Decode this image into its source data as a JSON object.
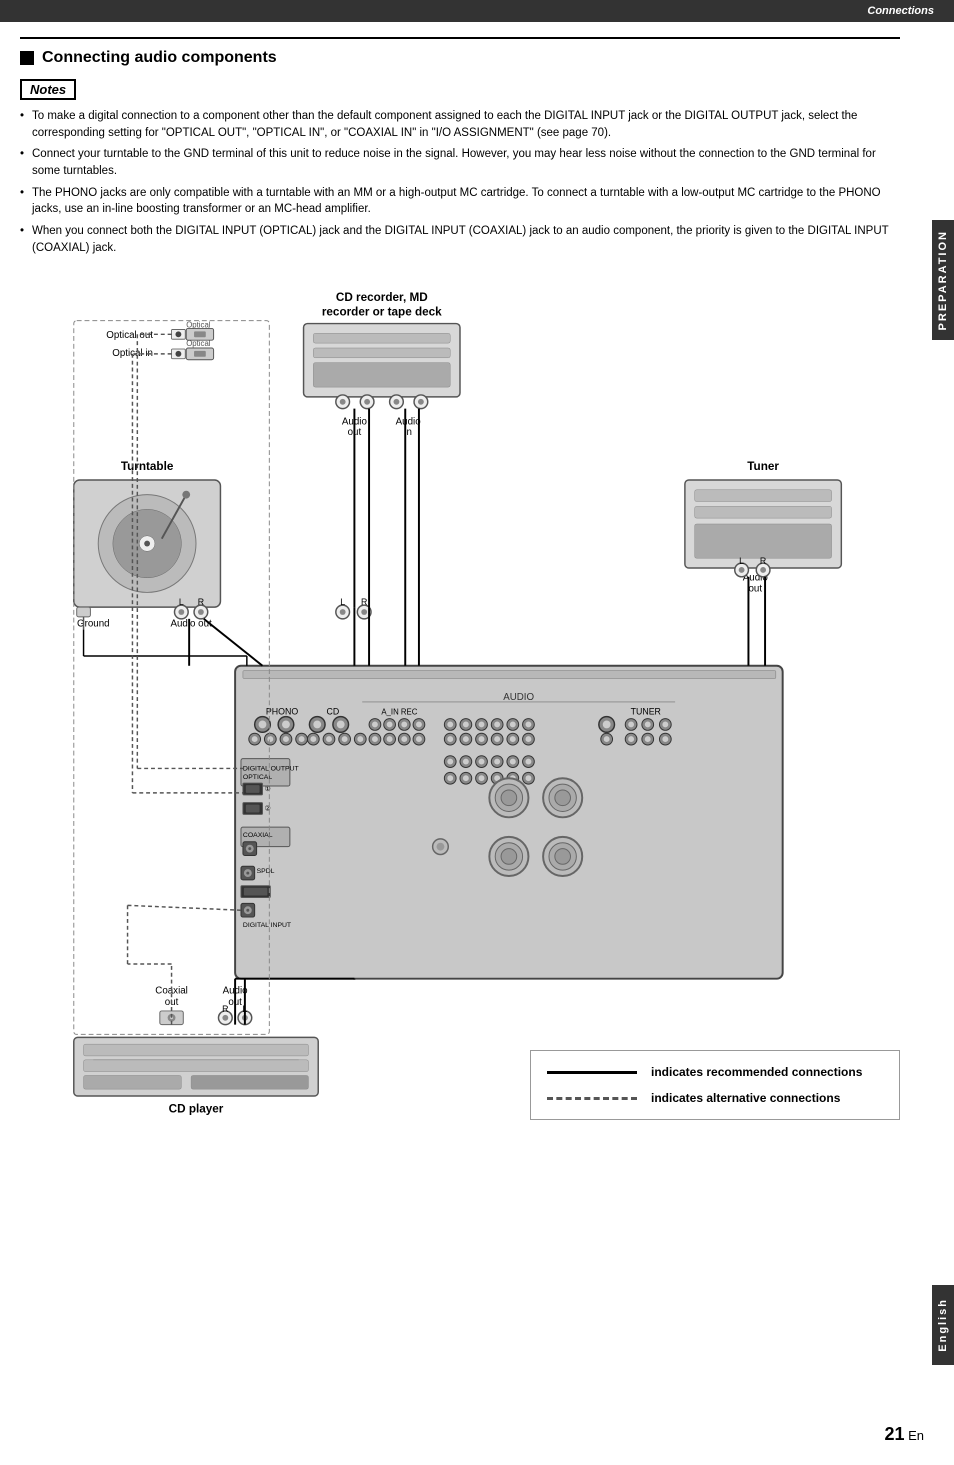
{
  "page": {
    "top_bar_label": "Connections",
    "side_tab_preparation": "PREPARATION",
    "side_tab_english": "English",
    "page_number": "21",
    "page_suffix": "En"
  },
  "section": {
    "title": "Connecting audio components"
  },
  "notes": {
    "label": "Notes",
    "bullets": [
      "To make a digital connection to a component other than the default component assigned to each the DIGITAL INPUT jack or the DIGITAL OUTPUT jack, select the corresponding setting for \"OPTICAL OUT\", \"OPTICAL IN\", or \"COAXIAL IN\" in \"I/O ASSIGNMENT\" (see page 70).",
      "Connect your turntable to the GND terminal of this unit to reduce noise in the signal. However, you may hear less noise without the connection to the GND terminal for some turntables.",
      "The PHONO jacks are only compatible with a turntable with an MM or a high-output MC cartridge. To connect a turntable with a low-output MC cartridge to the PHONO jacks, use an in-line boosting transformer or an MC-head amplifier.",
      "When you connect both the DIGITAL INPUT (OPTICAL) jack and the DIGITAL INPUT (COAXIAL) jack to an audio component, the priority is given to the DIGITAL INPUT (COAXIAL) jack."
    ]
  },
  "diagram": {
    "components": {
      "cd_recorder_label": "CD recorder, MD",
      "cd_recorder_sub": "recorder or tape deck",
      "turntable_label": "Turntable",
      "tuner_label": "Tuner",
      "cd_player_label": "CD player",
      "optical_out_label": "Optical out",
      "optical_in_label": "Optical in",
      "ground_label": "Ground",
      "audio_out_label1": "Audio out",
      "audio_out_label2": "Audio out",
      "audio_out_label3": "Audio out",
      "audio_in_label": "Audio in",
      "coaxial_out_label": "Coaxial out",
      "audio_out_bottom": "Audio out"
    },
    "legend": {
      "recommended_label": "indicates recommended connections",
      "alternative_label": "indicates alternative connections"
    }
  }
}
